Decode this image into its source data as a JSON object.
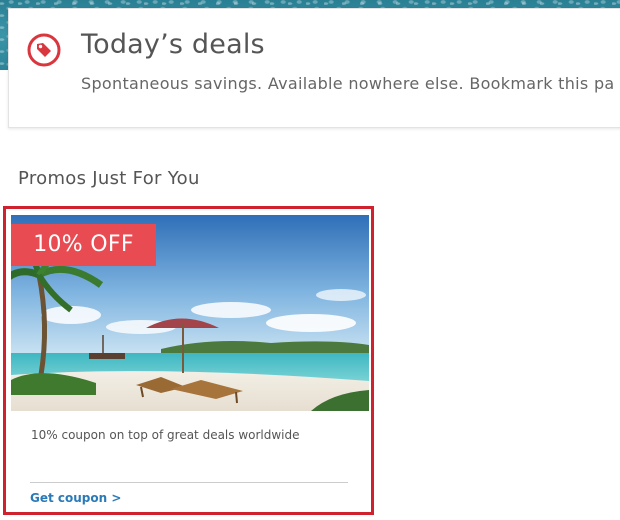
{
  "header": {
    "icon": "tag-icon",
    "icon_color": "#d9363e",
    "title": "Today’s deals",
    "subtitle": "Spontaneous savings. Available nowhere else. Bookmark this pa"
  },
  "promos_section": {
    "heading": "Promos Just For You",
    "cards": [
      {
        "badge": "10% OFF",
        "badge_color": "#e84c52",
        "image": "tropical-beach-photo",
        "description": "10% coupon on top of great deals worldwide",
        "link_label": "Get coupon >",
        "link_color": "#2a7ab8",
        "highlight_border_color": "#d0222e"
      }
    ]
  }
}
